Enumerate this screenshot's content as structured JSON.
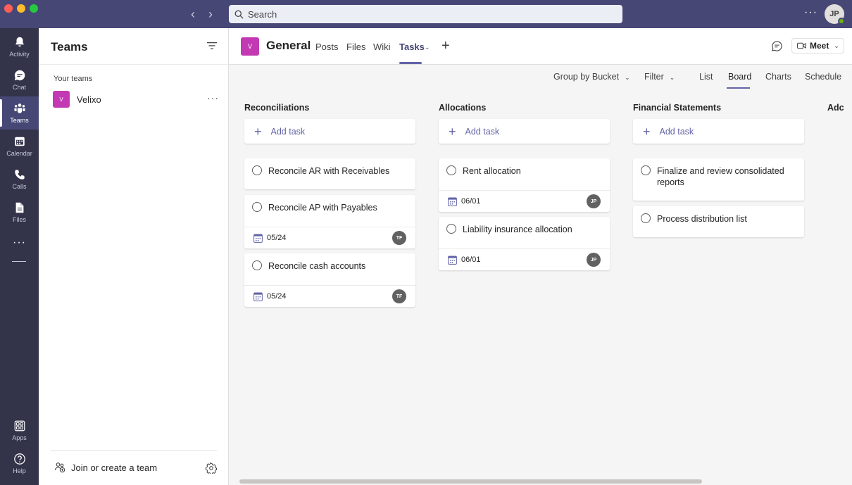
{
  "titlebar": {
    "search_placeholder": "Search",
    "more": "···",
    "me_initials": "JP"
  },
  "rail": {
    "items": [
      {
        "label": "Activity",
        "icon": "bell-icon"
      },
      {
        "label": "Chat",
        "icon": "chat-icon"
      },
      {
        "label": "Teams",
        "icon": "teams-icon"
      },
      {
        "label": "Calendar",
        "icon": "calendar-icon"
      },
      {
        "label": "Calls",
        "icon": "phone-icon"
      },
      {
        "label": "Files",
        "icon": "file-icon"
      },
      {
        "label": "Apps",
        "icon": "apps-icon"
      },
      {
        "label": "Help",
        "icon": "help-icon"
      }
    ],
    "more": "···"
  },
  "teams_pane": {
    "title": "Teams",
    "section": "Your teams",
    "teams": [
      {
        "avatar": "V",
        "name": "Velixo"
      }
    ],
    "team_more": "···",
    "join": "Join or create a team"
  },
  "channel": {
    "avatar": "V",
    "name": "General",
    "tabs": [
      "Posts",
      "Files",
      "Wiki",
      "Tasks"
    ],
    "active_tab": "Tasks",
    "meet": "Meet"
  },
  "toolbar": {
    "group_by": "Group by Bucket",
    "filter": "Filter",
    "views": [
      "List",
      "Board",
      "Charts",
      "Schedule"
    ],
    "active_view": "Board"
  },
  "board": {
    "add_task": "Add task",
    "buckets": [
      {
        "title": "Reconciliations",
        "tasks": [
          {
            "title": "Reconcile AR with Receivables",
            "due": "",
            "assignee": ""
          },
          {
            "title": "Reconcile AP with Payables",
            "due": "05/24",
            "assignee": "TF"
          },
          {
            "title": "Reconcile cash accounts",
            "due": "05/24",
            "assignee": "TF"
          }
        ]
      },
      {
        "title": "Allocations",
        "tasks": [
          {
            "title": "Rent allocation",
            "due": "06/01",
            "assignee": "JP"
          },
          {
            "title": "Liability insurance allocation",
            "due": "06/01",
            "assignee": "JP"
          }
        ]
      },
      {
        "title": "Financial Statements",
        "tasks": [
          {
            "title": "Finalize and review consolidated reports",
            "due": "",
            "assignee": ""
          },
          {
            "title": "Process distribution list",
            "due": "",
            "assignee": ""
          }
        ]
      },
      {
        "title": "Adc",
        "tasks": []
      }
    ]
  }
}
